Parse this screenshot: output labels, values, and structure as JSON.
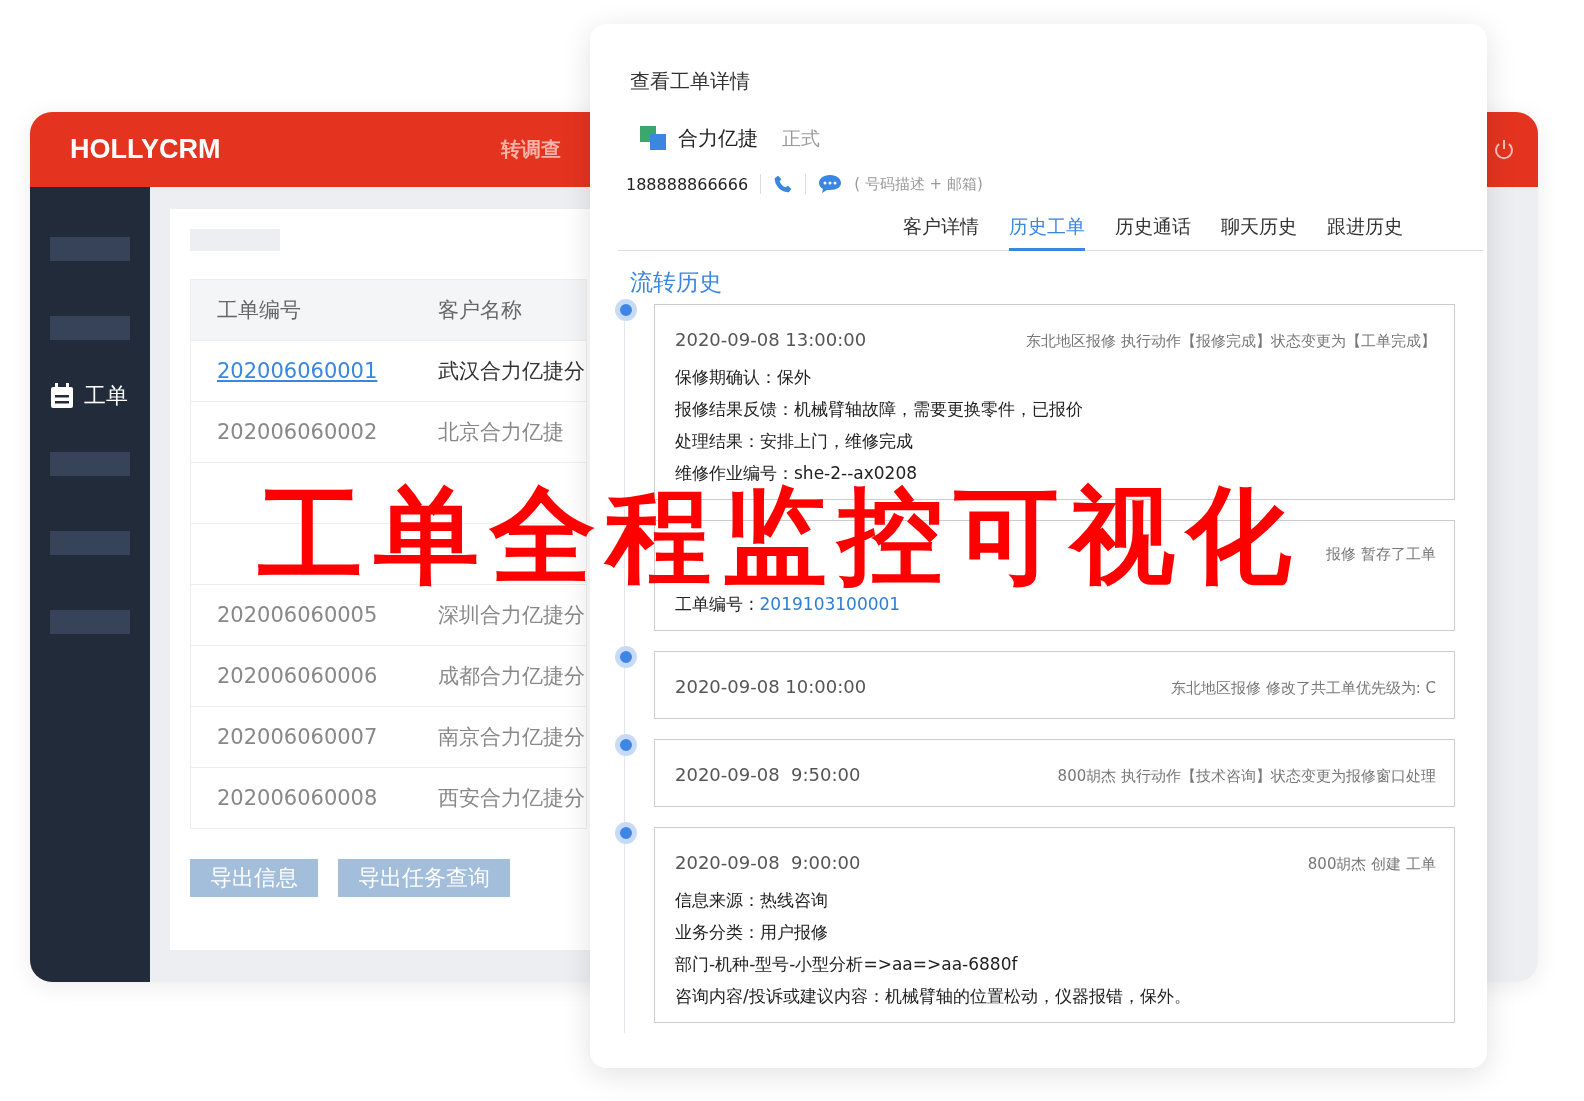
{
  "app": {
    "brand": "HOLLYCRM",
    "header_link": "转调查"
  },
  "sidebar": {
    "items": [
      {
        "kind": "placeholder"
      },
      {
        "kind": "placeholder"
      },
      {
        "kind": "item",
        "label": "工单"
      },
      {
        "kind": "placeholder"
      },
      {
        "kind": "placeholder"
      },
      {
        "kind": "placeholder"
      }
    ]
  },
  "table": {
    "columns": [
      "工单编号",
      "客户名称"
    ],
    "rows": [
      {
        "id": "202006060001",
        "name": "武汉合力亿捷分",
        "kind": "link"
      },
      {
        "id": "202006060002",
        "name": "北京合力亿捷",
        "kind": "plain"
      },
      {
        "kind": "covered"
      },
      {
        "kind": "covered"
      },
      {
        "id": "202006060005",
        "name": "深圳合力亿捷分",
        "kind": "plain"
      },
      {
        "id": "202006060006",
        "name": "成都合力亿捷分",
        "kind": "plain"
      },
      {
        "id": "202006060007",
        "name": "南京合力亿捷分",
        "kind": "plain"
      },
      {
        "id": "202006060008",
        "name": "西安合力亿捷分",
        "kind": "plain"
      }
    ]
  },
  "buttons": [
    "导出信息",
    "导出任务查询"
  ],
  "detail": {
    "title": "查看工单详情",
    "company": "合力亿捷",
    "company_tag": "正式",
    "phone": "188888866666",
    "contact_note": "( 号码描述 + 邮箱)",
    "tabs": [
      {
        "label": "客户详情",
        "selected": false
      },
      {
        "label": "历史工单",
        "selected": true
      },
      {
        "label": "历史通话",
        "selected": false
      },
      {
        "label": "聊天历史",
        "selected": false
      },
      {
        "label": "跟进历史",
        "selected": false
      }
    ],
    "section_title": "流转历史",
    "entries": [
      {
        "time": "2020-09-08 13:00:00",
        "action": "东北地区报修 执行动作【报修完成】状态变更为【工单完成】",
        "details": [
          {
            "kind": "plain",
            "text": "保修期确认：保外"
          },
          {
            "kind": "plain",
            "text": "报修结果反馈：机械臂轴故障，需要更换零件，已报价"
          },
          {
            "kind": "plain",
            "text": "处理结果：安排上门，维修完成"
          },
          {
            "kind": "plain",
            "text": "维修作业编号：she-2--ax0208"
          }
        ]
      },
      {
        "dot": false,
        "action": "报修 暂存了工单",
        "details": [
          {
            "kind": "link",
            "text": "工单编号 :",
            "link": "2019103100001"
          }
        ]
      },
      {
        "time": "2020-09-08 10:00:00",
        "action": "东北地区报修 修改了共工单优先级为: C"
      },
      {
        "time": "2020-09-08  9:50:00",
        "action": "800胡杰 执行动作【技术咨询】状态变更为报修窗口处理"
      },
      {
        "time": "2020-09-08  9:00:00",
        "action": "800胡杰 创建 工单",
        "details": [
          {
            "kind": "plain",
            "text": "信息来源：热线咨询"
          },
          {
            "kind": "plain",
            "text": "业务分类：用户报修"
          },
          {
            "kind": "plain",
            "text": "部门-机种-型号-小型分析=>aa=>aa-6880f"
          },
          {
            "kind": "plain",
            "text": "咨询内容/投诉或建议内容：机械臂轴的位置松动，仪器报错，保外。"
          }
        ]
      }
    ]
  },
  "headline": "工单全程监控可视化"
}
